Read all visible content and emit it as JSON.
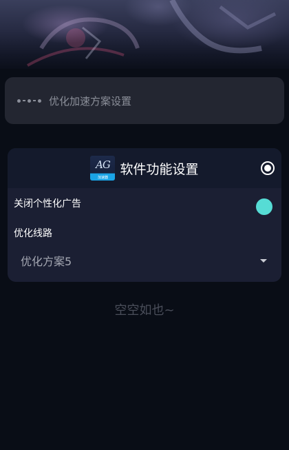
{
  "speed": {
    "label": "优化加速方案设置"
  },
  "card": {
    "logo_text": "AG",
    "logo_sub": "加速器",
    "title": "软件功能设置",
    "ads_label": "关闭个性化广告",
    "ads_toggle_on": true,
    "route_label": "优化线路",
    "route_value": "优化方案5"
  },
  "empty_text": "空空如也~",
  "colors": {
    "background": "#090d16",
    "card": "#1b1f33",
    "card_header": "#141a2c",
    "toggle": "#56dcd5",
    "speed_box": "#232631"
  }
}
